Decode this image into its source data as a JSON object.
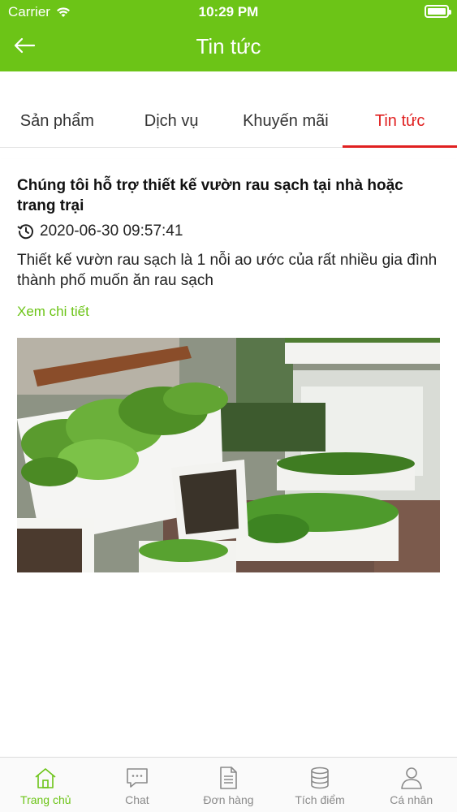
{
  "status_bar": {
    "carrier": "Carrier",
    "time": "10:29 PM",
    "wifi_icon": "wifi-icon",
    "battery_icon": "battery-icon"
  },
  "header": {
    "title": "Tin tức",
    "back_icon": "back-arrow-icon",
    "color": "#6cc417"
  },
  "tabs": [
    {
      "label": "Sản phẩm",
      "active": false
    },
    {
      "label": "Dịch vụ",
      "active": false
    },
    {
      "label": "Khuyến mãi",
      "active": false
    },
    {
      "label": "Tin tức",
      "active": true
    }
  ],
  "active_tab_color": "#e02020",
  "article": {
    "title": "Chúng tôi hỗ trợ thiết kế vườn rau sạch tại nhà hoặc trang trại",
    "date": "2020-06-30 09:57:41",
    "description": "Thiết kế vườn rau sạch là 1 nỗi ao ước của rất nhiều gia đình thành phố muốn ăn rau sạch",
    "more_link": "Xem chi tiết",
    "image": "vegetable-garden-photo"
  },
  "tabbar": {
    "items": [
      {
        "label": "Trang chủ",
        "icon": "home-icon",
        "active": true
      },
      {
        "label": "Chat",
        "icon": "chat-icon",
        "active": false
      },
      {
        "label": "Đơn hàng",
        "icon": "document-icon",
        "active": false
      },
      {
        "label": "Tích điểm",
        "icon": "database-icon",
        "active": false
      },
      {
        "label": "Cá nhân",
        "icon": "user-icon",
        "active": false
      }
    ]
  }
}
